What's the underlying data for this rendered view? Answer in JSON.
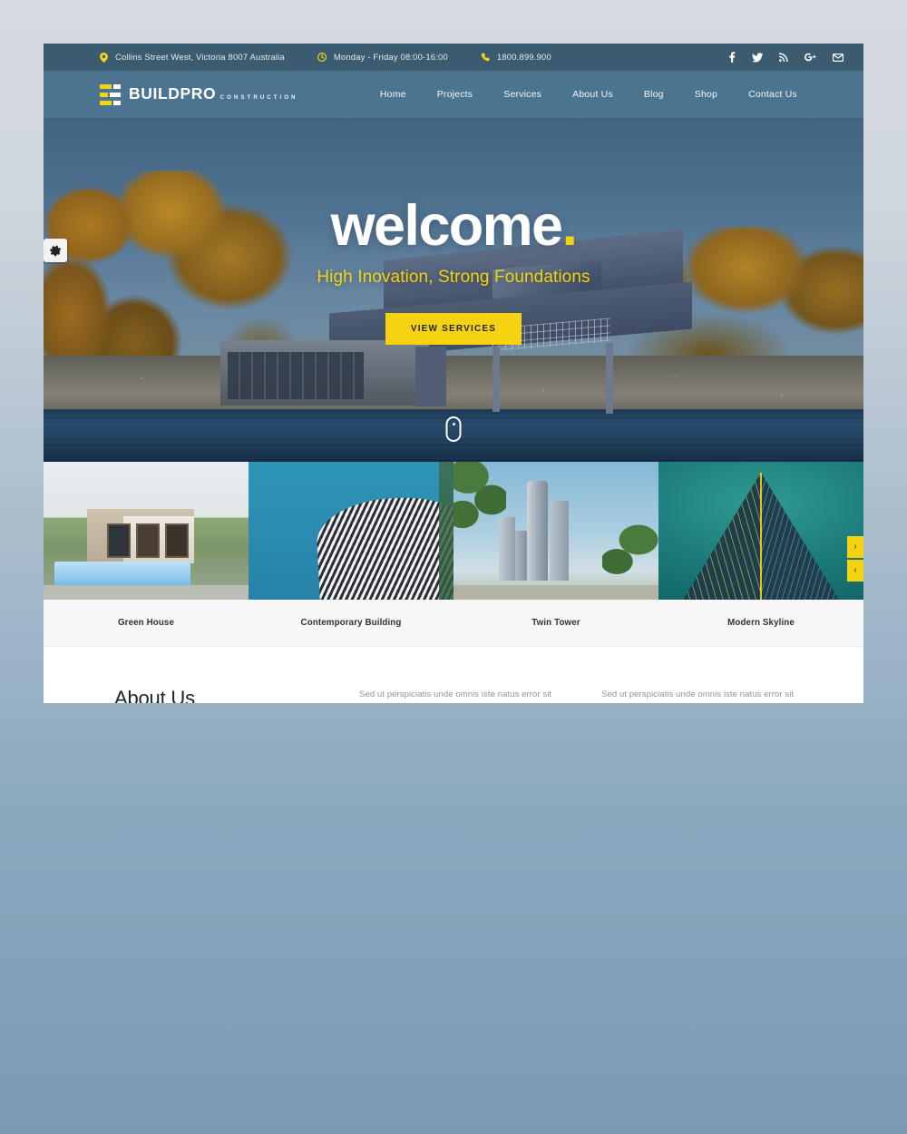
{
  "topbar": {
    "address": "Collins Street West, Victoria 8007 Australia",
    "hours": "Monday - Friday 08:00-16:00",
    "phone": "1800.899.900",
    "icons": {
      "address": "map-pin-icon",
      "hours": "clock-icon",
      "phone": "phone-icon"
    },
    "social": [
      {
        "name": "facebook-icon",
        "label": "f"
      },
      {
        "name": "twitter-icon",
        "label": "t"
      },
      {
        "name": "rss-icon",
        "label": "rss"
      },
      {
        "name": "google-plus-icon",
        "label": "G+"
      },
      {
        "name": "envelope-icon",
        "label": "mail"
      }
    ]
  },
  "header": {
    "logo_name": "BUILDPRO",
    "logo_sub": "CONSTRUCTION",
    "nav": [
      {
        "label": "Home"
      },
      {
        "label": "Projects"
      },
      {
        "label": "Services"
      },
      {
        "label": "About Us"
      },
      {
        "label": "Blog"
      },
      {
        "label": "Shop"
      },
      {
        "label": "Contact Us"
      }
    ]
  },
  "hero": {
    "title": "welcome",
    "title_dot": ".",
    "subtitle": "High Inovation, Strong Foundations",
    "cta": "VIEW SERVICES",
    "settings_icon": "gear-icon",
    "scroll_icon": "scroll-mouse-icon"
  },
  "projects": {
    "items": [
      {
        "caption": "Green House"
      },
      {
        "caption": "Contemporary Building"
      },
      {
        "caption": "Twin Tower"
      },
      {
        "caption": "Modern Skyline"
      }
    ],
    "nav": {
      "next": "›",
      "prev": "‹"
    }
  },
  "about": {
    "title": "About Us",
    "col1": "Sed ut perspiciatis unde omnis iste natus error sit voluptatem accusantium doloremque laudantium, totam rem aperiam, eaque ipsa quae ab illo inventore veritatis et quasi architecto beatae. Sed ut perspiciatis",
    "col2": "Sed ut perspiciatis unde omnis iste natus error sit voluptatem accusantium doloremque laudantium, totam rem aperiam, eaque ipsa quae ab illo inventore veritatis et quasi architecto beatae. Sed ut perspiciatis"
  },
  "colors": {
    "accent": "#f5d311",
    "topbar_bg": "#3b5c70",
    "header_bg": "#4a7490",
    "page_bg_top": "#d5dae0",
    "page_bg_bottom": "#7b9bb3"
  }
}
